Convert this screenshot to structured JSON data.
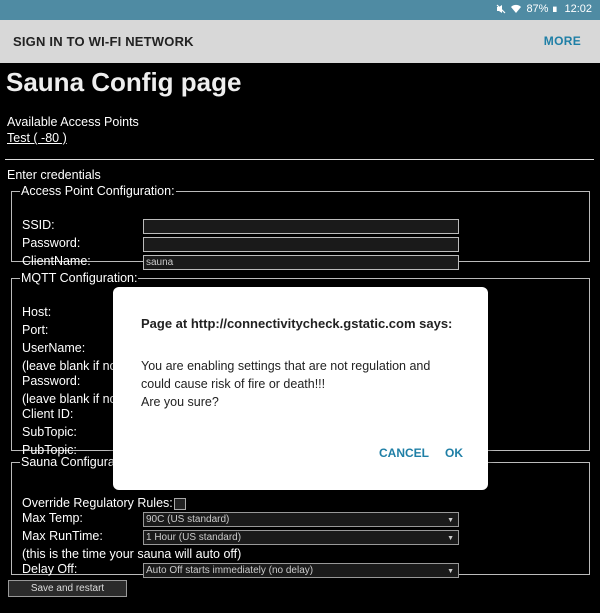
{
  "statusbar": {
    "battery": "87%",
    "time": "12:02",
    "icons": [
      "mute-icon",
      "wifi-icon",
      "battery-icon"
    ]
  },
  "appbar": {
    "title": "SIGN IN TO WI-FI NETWORK",
    "more": "MORE"
  },
  "page": {
    "title": "Sauna Config page",
    "available_label": "Available Access Points",
    "ap_link": "Test  ( -80 )",
    "enter_credentials": "Enter credentials"
  },
  "ap_config": {
    "legend": "Access Point Configuration:",
    "ssid_label": "SSID:",
    "ssid_value": "",
    "password_label": "Password:",
    "password_value": "",
    "clientname_label": "ClientName:",
    "clientname_value": "sauna"
  },
  "mqtt": {
    "legend": "MQTT Configuration:",
    "host_label": "Host:",
    "port_label": "Port:",
    "username_label": "UserName:",
    "leave_blank_1": "(leave blank if no",
    "password_label": "Password:",
    "leave_blank_2": "(leave blank if no",
    "clientid_label": "Client ID:",
    "subtopic_label": "SubTopic:",
    "pubtopic_label": "PubTopic:"
  },
  "sauna": {
    "legend": "Sauna Configura",
    "override_label": "Override Regulatory Rules:",
    "maxtemp_label": "Max Temp:",
    "maxtemp_value": "90C (US standard)",
    "maxruntime_label": "Max RunTime:",
    "maxruntime_value": "1 Hour (US standard)",
    "runtime_note": "(this is the time your sauna will auto off)",
    "delayoff_label": "Delay Off:",
    "delayoff_value": "Auto Off starts immediately (no delay)"
  },
  "save_button": "Save and restart",
  "dialog": {
    "title": "Page at http://connectivitycheck.gstatic.com says:",
    "message_line1": "You are enabling settings that are not regulation and",
    "message_line2": "could cause risk of fire or death!!!",
    "message_line3": "Are you sure?",
    "cancel": "CANCEL",
    "ok": "OK"
  },
  "colors": {
    "statusbar": "#4f8ba3",
    "appbar": "#d8d8d8",
    "accent": "#1f7fa6",
    "page_bg": "#000000"
  }
}
